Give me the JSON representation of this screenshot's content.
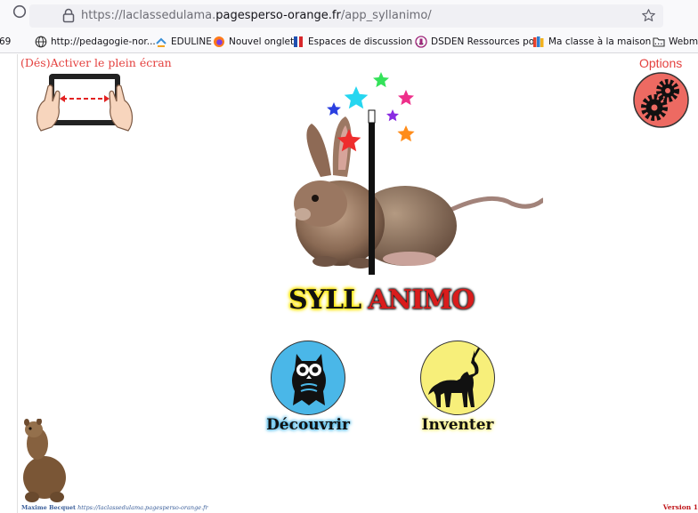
{
  "browser": {
    "url_prefix": "https://laclassedulama.",
    "url_host": "pagesperso-orange.fr",
    "url_path": "/app_syllanimo/",
    "bookmarks": [
      {
        "label": "69"
      },
      {
        "label": "http://pedagogie-nor..."
      },
      {
        "label": "EDULINE"
      },
      {
        "label": "Nouvel onglet"
      },
      {
        "label": "Espaces de discussion ..."
      },
      {
        "label": "DSDEN Ressources po..."
      },
      {
        "label": "Ma classe à la maison ..."
      },
      {
        "label": "Webme"
      }
    ]
  },
  "page": {
    "fullscreen_label": "(Dés)Activer le plein écran",
    "options_label": "Options",
    "title_part1": "SYLL",
    "title_part2": "ANIMO",
    "modes": [
      {
        "label": "Découvrir"
      },
      {
        "label": "Inventer"
      }
    ],
    "footer_author": "Maxime Becquet",
    "footer_site": "https://laclassedulama.pagesperso-orange.fr",
    "version": "Version 1"
  },
  "colors": {
    "accent_red": "#e4413f",
    "title_yellow": "#ffe600",
    "title_red": "#d91c1c",
    "decouvrir_blue": "#4ab7e8",
    "inventer_yellow": "#f7ef7a"
  }
}
